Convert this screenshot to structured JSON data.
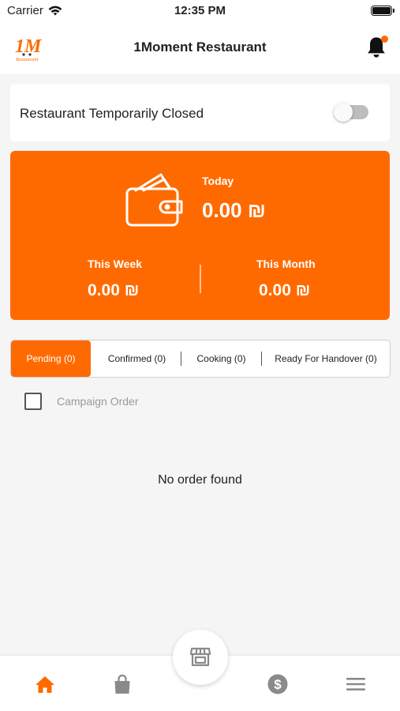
{
  "status_bar": {
    "carrier": "Carrier",
    "time": "12:35 PM",
    "wifi_icon": "wifi-icon",
    "battery_icon": "battery-icon"
  },
  "header": {
    "title": "1Moment Restaurant",
    "logo_text": "Restaurant",
    "notification_icon": "bell-icon",
    "has_unread": true
  },
  "closed_toggle": {
    "label": "Restaurant Temporarily Closed",
    "on": false
  },
  "earnings": {
    "today_label": "Today",
    "today_value": "0.00 ₪",
    "week_label": "This Week",
    "week_value": "0.00 ₪",
    "month_label": "This Month",
    "month_value": "0.00 ₪",
    "icon": "wallet-icon"
  },
  "tabs": [
    {
      "label": "Pending (0)",
      "active": true
    },
    {
      "label": "Confirmed (0)",
      "active": false
    },
    {
      "label": "Cooking (0)",
      "active": false
    },
    {
      "label": "Ready For Handover (0)",
      "active": false
    }
  ],
  "campaign_filter": {
    "label": "Campaign Order",
    "checked": false
  },
  "empty_state": "No order found",
  "bottom_nav": {
    "items": [
      {
        "icon": "home-icon",
        "active": true
      },
      {
        "icon": "shopping-bag-icon",
        "active": false
      },
      {
        "icon": "store-icon",
        "active": false
      },
      {
        "icon": "dollar-icon",
        "active": false
      },
      {
        "icon": "menu-icon",
        "active": false
      }
    ]
  },
  "colors": {
    "accent": "#ff6a00",
    "inactive_icon": "#8a8a8a",
    "background": "#f5f5f5"
  }
}
